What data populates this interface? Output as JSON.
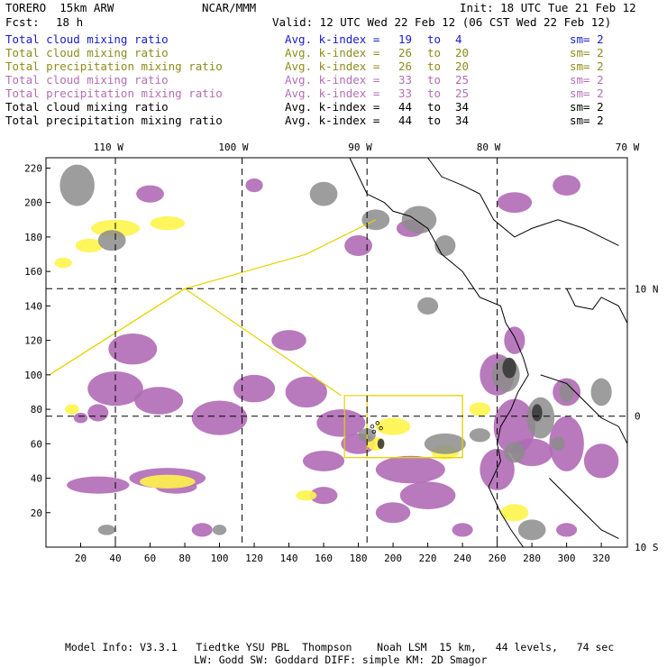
{
  "header": {
    "model_name": "TORERO  15km ARW",
    "org": "NCAR/MMM",
    "init": "Init: 18 UTC Tue 21 Feb 12",
    "fcst_label": "Fcst:",
    "fcst_value": "18 h",
    "valid": "Valid: 12 UTC Wed 22 Feb 12 (06 CST Wed 22 Feb 12)"
  },
  "legend": [
    {
      "field": "Total cloud mixing ratio",
      "avg": "Avg. k-index =",
      "from": "19",
      "to": "to",
      "till": "4",
      "sm": "sm= 2",
      "color": "#1a1acc"
    },
    {
      "field": "Total cloud mixing ratio",
      "avg": "Avg. k-index =",
      "from": "26",
      "to": "to",
      "till": "20",
      "sm": "sm= 2",
      "color": "#8c8c1a"
    },
    {
      "field": "Total precipitation mixing ratio",
      "avg": "Avg. k-index =",
      "from": "26",
      "to": "to",
      "till": "20",
      "sm": "sm= 2",
      "color": "#8c8c1a"
    },
    {
      "field": "Total cloud mixing ratio",
      "avg": "Avg. k-index =",
      "from": "33",
      "to": "to",
      "till": "25",
      "sm": "sm= 2",
      "color": "#b46eb4"
    },
    {
      "field": "Total precipitation mixing ratio",
      "avg": "Avg. k-index =",
      "from": "33",
      "to": "to",
      "till": "25",
      "sm": "sm= 2",
      "color": "#b46eb4"
    },
    {
      "field": "Total cloud mixing ratio",
      "avg": "Avg. k-index =",
      "from": "44",
      "to": "to",
      "till": "34",
      "sm": "sm= 2",
      "color": "#000000"
    },
    {
      "field": "Total precipitation mixing ratio",
      "avg": "Avg. k-index =",
      "from": "44",
      "to": "to",
      "till": "34",
      "sm": "sm= 2",
      "color": "#000000"
    }
  ],
  "map": {
    "lon_labels": [
      "110 W",
      "100 W",
      "90 W",
      "80 W",
      "70 W"
    ],
    "lat_labels": [
      "10 N",
      "0",
      "10 S"
    ],
    "x_ticks": [
      "20",
      "40",
      "60",
      "80",
      "100",
      "120",
      "140",
      "160",
      "180",
      "200",
      "220",
      "240",
      "260",
      "280",
      "300",
      "320"
    ],
    "y_ticks": [
      "20",
      "40",
      "60",
      "80",
      "100",
      "120",
      "140",
      "160",
      "180",
      "200",
      "220"
    ],
    "x_range": [
      0,
      335
    ],
    "y_range": [
      0,
      226
    ],
    "grid_lon_x": [
      40,
      113,
      185,
      260
    ],
    "grid_lat_y": [
      76,
      150
    ],
    "colors": {
      "purple": "#b06ab6",
      "yellow": "#fff44a",
      "gray": "#8c8c8c",
      "dark": "#3a3a3a",
      "line_yellow": "#e6d200"
    },
    "domain_box": [
      [
        172,
        52
      ],
      [
        240,
        52
      ],
      [
        240,
        88
      ],
      [
        172,
        88
      ]
    ],
    "inner_box": [
      [
        185,
        52
      ],
      [
        240,
        52
      ],
      [
        240,
        88
      ],
      [
        185,
        88
      ]
    ],
    "track": [
      [
        2,
        100
      ],
      [
        80,
        150
      ],
      [
        150,
        170
      ],
      [
        190,
        190
      ]
    ],
    "track2": [
      [
        2,
        100
      ],
      [
        80,
        150
      ],
      [
        170,
        88
      ]
    ]
  },
  "footer": {
    "line1": "Model Info: V3.3.1   Tiedtke YSU PBL  Thompson    Noah LSM  15 km,   44 levels,   74 sec",
    "line2": "LW: Godd SW: Goddard DIFF: simple KM: 2D Smagor"
  }
}
